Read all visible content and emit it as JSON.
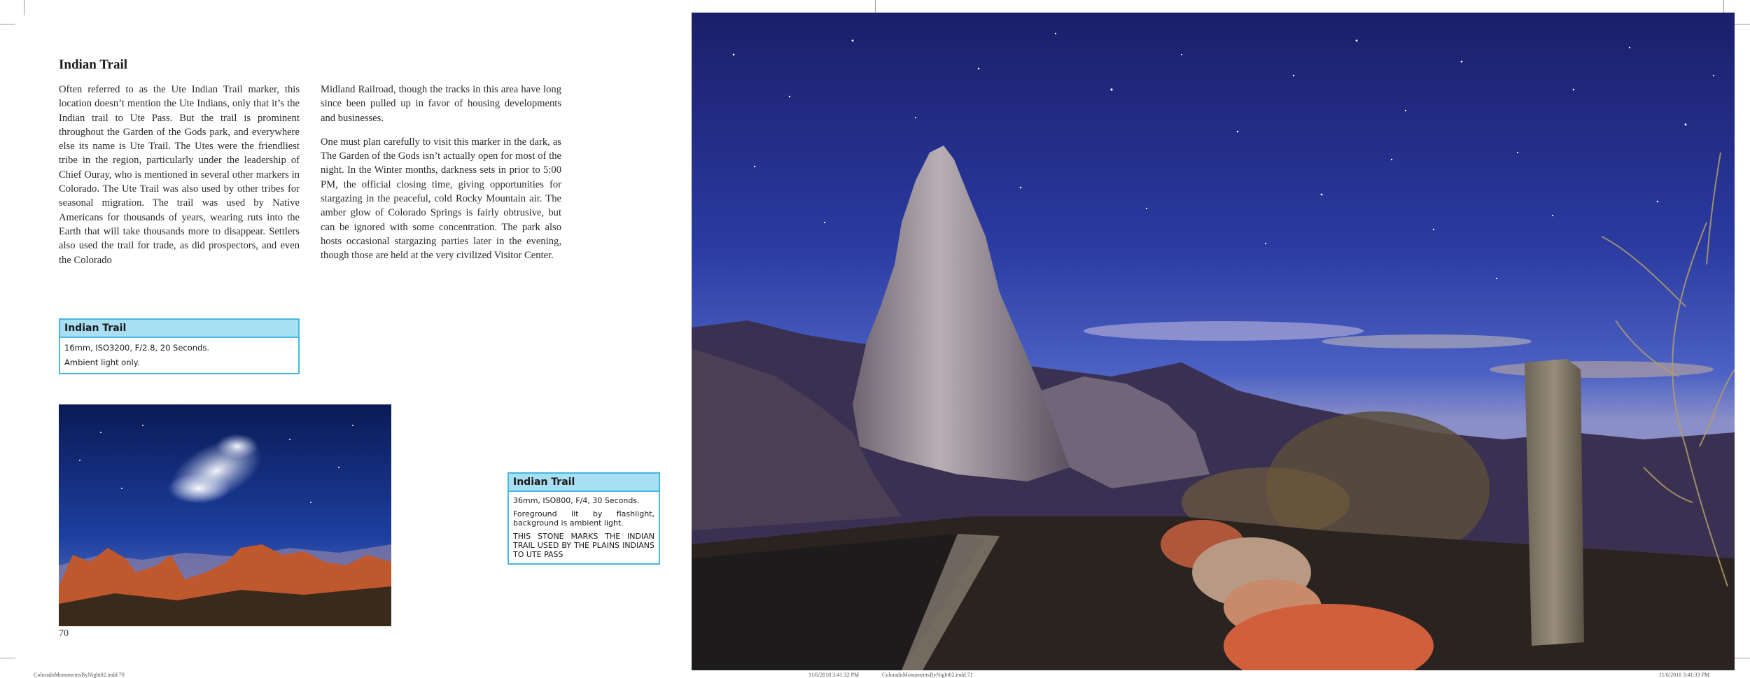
{
  "page": {
    "heading": "Indian Trail",
    "page_number": "70",
    "col1_paragraphs": [
      "Often referred to as the Ute Indian Trail marker, this location doesn’t mention the Ute Indians, only that it’s the Indian trail to Ute Pass. But the trail is prominent throughout the Garden of the Gods park, and everywhere else its name is Ute Trail. The Utes were the friendliest tribe in the region, particularly under the leadership of Chief Ouray, who is mentioned in several other markers in Colorado. The Ute Trail was also used by other tribes for seasonal migration. The trail was used by Native Americans for thousands of years, wearing ruts into the Earth that will take thousands more to disappear. Settlers also used the trail for trade, as did prospectors, and even the Colorado"
    ],
    "col2_paragraphs": [
      "Midland Railroad, though the tracks in this area have long since been pulled up in favor of housing developments and businesses.",
      "One must plan carefully to visit this marker in the dark, as The Garden of the Gods isn’t actually open for most of the night. In the Winter months, darkness sets in prior to 5:00 PM, the official closing time, giving opportunities for stargazing in the peaceful, cold Rocky Mountain air. The amber glow of Colorado Springs is fairly obtrusive, but can be ignored with some concentration. The park also hosts occasional stargazing parties later in the evening, though those are held at the very civilized Visitor Center."
    ]
  },
  "box1": {
    "title": "Indian Trail",
    "settings": "16mm, ISO3200, F/2.8, 20 Seconds.",
    "note": "Ambient light only."
  },
  "box2": {
    "title": "Indian Trail",
    "settings": "36mm, ISO800, F/4, 30 Seconds.",
    "note": "Foreground lit by flashlight, background is ambient light.",
    "inscription": "THIS STONE MARKS THE INDIAN TRAIL USED BY THE PLAINS INDIANS TO UTE PASS"
  },
  "slugs": {
    "left_file": "ColoradoMonumentsByNight02.indd   70",
    "left_date": "11/6/2018   3:41:32 PM",
    "right_file": "ColoradoMonumentsByNight02.indd   71",
    "right_date": "11/6/2018   3:41:33 PM"
  },
  "colors": {
    "box_border": "#47b8e0",
    "box_title_bg": "#a8dff3",
    "night_sky": "#1b2a7a"
  }
}
